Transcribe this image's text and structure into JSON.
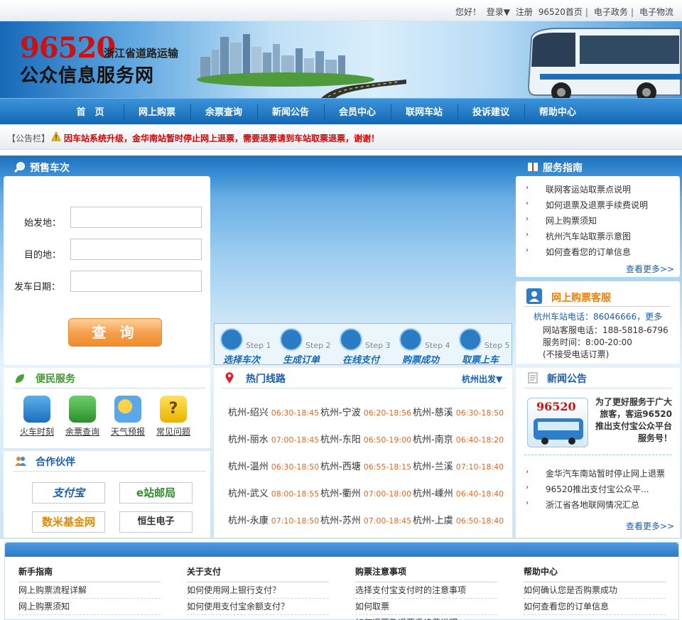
{
  "topbar": {
    "greeting": "您好！",
    "login": "登录▼",
    "register": "注册",
    "home_link": "96520首页",
    "gov": "电子政务",
    "logistics": "电子物流"
  },
  "brand": {
    "number": "96520",
    "subtitle": "浙江省道路运输",
    "title": "公众信息服务网"
  },
  "nav": [
    "首　页",
    "网上购票",
    "余票查询",
    "新闻公告",
    "会员中心",
    "联网车站",
    "投诉建议",
    "帮助中心"
  ],
  "notice": {
    "label": "【公告栏】",
    "message": "因车站系统升级，金华南站暂时停止网上退票，需要退票请到车站取票退票，谢谢！"
  },
  "presale": {
    "title": "预售车次",
    "from_label": "始发地：",
    "to_label": "目的地：",
    "date_label": "发车日期：",
    "query_button": "查 询"
  },
  "steps": [
    {
      "num": "Step 1",
      "label": "选择车次"
    },
    {
      "num": "Step 2",
      "label": "生成订单"
    },
    {
      "num": "Step 3",
      "label": "在线支付"
    },
    {
      "num": "Step 4",
      "label": "购票成功"
    },
    {
      "num": "Step 5",
      "label": "取票上车"
    }
  ],
  "guide": {
    "title": "服务指南",
    "items": [
      "联网客运站取票点说明",
      "如何退票及退票手续费说明",
      "网上购票须知",
      "杭州汽车站取票示意图",
      "如何查看您的订单信息"
    ],
    "more": "查看更多>>"
  },
  "service": {
    "title": "网上购票客服",
    "hz_phone": "杭州车站电话：86046666，更多",
    "web_phone": "网站客服电话：188-5818-6796",
    "hours": "服务时间：8:00-20:00",
    "note": "(不接受电话订票)"
  },
  "convenience": {
    "title": "便民服务",
    "items": [
      "火车时刻",
      "余票查询",
      "天气预报",
      "常见问题"
    ]
  },
  "partners": {
    "title": "合作伙伴",
    "items": [
      "支付宝",
      "e站邮局",
      "数米基金网",
      "恒生电子"
    ]
  },
  "hotroutes": {
    "title": "热门线路",
    "depart": "杭州出发▼",
    "rows": [
      [
        {
          "r": "杭州-绍兴",
          "t": "06:30-18:45"
        },
        {
          "r": "杭州-宁波",
          "t": "06:20-18:56"
        },
        {
          "r": "杭州-慈溪",
          "t": "06:30-18:50"
        }
      ],
      [
        {
          "r": "杭州-丽水",
          "t": "07:00-18:45"
        },
        {
          "r": "杭州-东阳",
          "t": "06:50-19:00"
        },
        {
          "r": "杭州-南京",
          "t": "06:40-18:20"
        }
      ],
      [
        {
          "r": "杭州-温州",
          "t": "06:30-18:50"
        },
        {
          "r": "杭州-西塘",
          "t": "06:55-18:15"
        },
        {
          "r": "杭州-兰溪",
          "t": "07:10-18:40"
        }
      ],
      [
        {
          "r": "杭州-武义",
          "t": "08:00-18:55"
        },
        {
          "r": "杭州-衢州",
          "t": "07:00-18:00"
        },
        {
          "r": "杭州-嵊州",
          "t": "06:40-18:40"
        }
      ],
      [
        {
          "r": "杭州-永康",
          "t": "07:10-18:50"
        },
        {
          "r": "杭州-苏州",
          "t": "07:00-18:45"
        },
        {
          "r": "杭州-上虞",
          "t": "06:50-18:40"
        }
      ]
    ]
  },
  "news": {
    "title": "新闻公告",
    "promo_num": "96520",
    "promo_text": "为了更好服务于广大旅客，客运96520推出支付宝公众平台服务号！",
    "items": [
      "金华汽车南站暂时停止网上退票",
      "96520推出支付宝公众平...",
      "浙江省各地联网情况汇总"
    ],
    "more": "查看更多>>"
  },
  "footer": [
    {
      "title": "新手指南",
      "items": [
        "网上购票流程详解",
        "网上购票须知"
      ]
    },
    {
      "title": "关于支付",
      "items": [
        "如何使用网上银行支付？",
        "如何使用支付宝余额支付？"
      ]
    },
    {
      "title": "购票注意事项",
      "items": [
        "选择支付宝支付时的注意事项",
        "如何取票",
        "如何退票及退票手续费说明"
      ]
    },
    {
      "title": "帮助中心",
      "items": [
        "如何确认您是否购票成功",
        "如何查看您的订单信息"
      ]
    }
  ]
}
